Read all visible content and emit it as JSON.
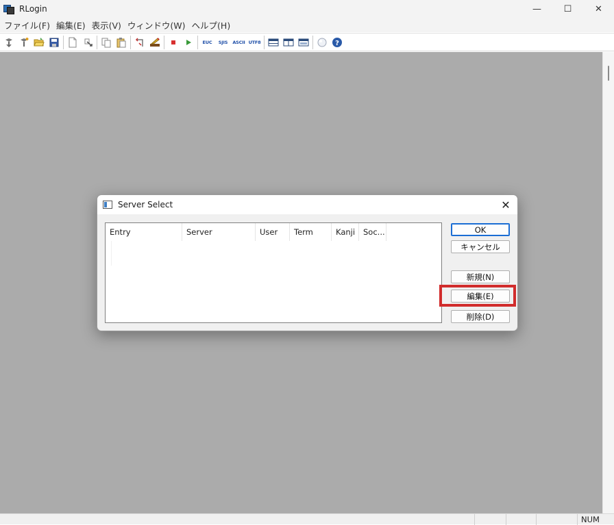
{
  "window": {
    "title": "RLogin",
    "minimize": "—",
    "maximize": "☐",
    "close": "✕"
  },
  "menu": [
    "ファイル(F)",
    "編集(E)",
    "表示(V)",
    "ウィンドウ(W)",
    "ヘルプ(H)"
  ],
  "toolbar": {
    "encodings": [
      "EUC",
      "SJIS",
      "ASCII",
      "UTF8"
    ],
    "icons": [
      "connect-icon",
      "reconnect-icon",
      "open-folder-icon",
      "save-icon",
      "new-document-icon",
      "transfer-icon",
      "copy-icon",
      "paste-icon",
      "undo-icon",
      "edit-icon",
      "stop-icon",
      "play-icon",
      "window-split-icon",
      "window-columns-icon",
      "window-single-icon",
      "sphere-icon",
      "help-icon"
    ]
  },
  "dialog": {
    "title": "Server Select",
    "close": "✕",
    "columns": [
      "Entry",
      "Server",
      "User",
      "Term",
      "Kanji",
      "Soc..."
    ],
    "buttons": {
      "ok": "OK",
      "cancel": "キャンセル",
      "new": "新規(N)",
      "edit": "編集(E)",
      "delete": "削除(D)"
    }
  },
  "statusbar": {
    "num": "NUM"
  },
  "colors": {
    "highlight": "#d12c2c",
    "workspace": "#ababab",
    "default_button_border": "#1a6dd4"
  }
}
